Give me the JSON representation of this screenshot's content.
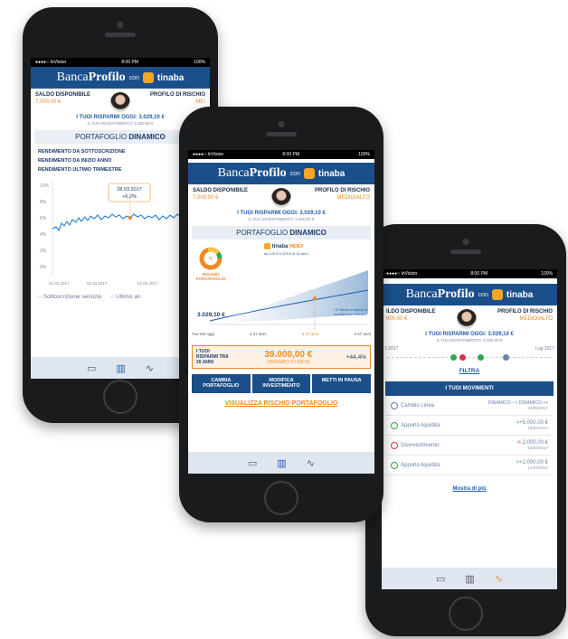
{
  "status": {
    "carrier": "●●●●○ InVision",
    "time": "8:00 PM",
    "battery": "100%"
  },
  "brand": {
    "banca": "Banca",
    "profilo": "Profilo",
    "con": "con",
    "tinaba": "tinaba"
  },
  "account": {
    "saldo_label": "SALDO DISPONIBILE",
    "saldo_value": "7.000,00 €",
    "rischio_label": "PROFILO DI RISCHIO",
    "rischio_value": "MEDIO/ALTO",
    "rischio_value_short": "MEI",
    "saldo_value_short": "000,00 €",
    "saldo_label_short": "ILDO DISPONIBILE",
    "savings": "I TUOI RISPARMI OGGI: 3.029,10 €",
    "invest": "IL TUO INVESTIMENTO: 3.000,00 €"
  },
  "portfolio": {
    "prefix": "PORTAFOGLIO",
    "name": "DINAMICO"
  },
  "phone1": {
    "rendimenti": [
      "RENDIMENTO DA SOTTOSCRIZIONE",
      "RENDIMENTO DA INIZIO ANNO",
      "RENDIMENTO ULTIMO TRIMESTRE"
    ],
    "y_ticks": [
      "10%",
      "8%",
      "6%",
      "4%",
      "2%",
      "0%"
    ],
    "x_ticks": [
      "01.01.2017",
      "01.03.2017",
      "01.05.2017",
      "01"
    ],
    "tooltip_date": "28.03.2017",
    "tooltip_value": "+6,2%",
    "radio1": "Sottoscrizione servizio",
    "radio2": "Ultimo an"
  },
  "phone2": {
    "rischio_title": "RISCHIO PORTAFOGLIO",
    "index_brand": "tinaba",
    "index_label": "INDEX",
    "index_sub": "da 100 € a 229 € in 20 anni",
    "start_value": "3.029,10 €",
    "note": "+€ Valore e banda di oscillazione indicativi",
    "ages": [
      "Tua età oggi",
      "a 37 anni",
      "a 47 anni",
      "a 57 anni"
    ],
    "proj_label": "I TUOI RISPARMI TRA 20 ANNI",
    "proj_value": "39.000,00 €",
    "proj_sub": "(VERSATO 27.000 €)",
    "proj_pct": "+44,4%",
    "buttons": [
      "CAMBIA PORTAFOGLIO",
      "MODIFICA INVESTIMENTO",
      "METTI IN PAUSA"
    ],
    "link": "VISUALIZZA RISCHIO PORTAFOGLIO"
  },
  "phone3": {
    "timeline_start": "1.2017",
    "timeline_end": "Lug 2017",
    "filter": "FILTRA",
    "movements_title": "I TUOI MOVIMENTI",
    "movements": [
      {
        "name": "Cambio Linea",
        "amount": "DINAMICO --> DINAMICO ++",
        "date": "22/05/2017",
        "color": "#6b82a8"
      },
      {
        "name": "Apporto liquidità",
        "amount": "+5.000,00 €",
        "date": "18/04/2017",
        "color": "#2fa84f"
      },
      {
        "name": "Disinvestimento",
        "amount": "-2.000,00 €",
        "date": "15/04/2017",
        "color": "#d8344a"
      },
      {
        "name": "Apporto liquidità",
        "amount": "+2.000,00 €",
        "date": "12/04/2017",
        "color": "#2fa84f"
      }
    ],
    "more": "Mostra di più"
  },
  "tabbar": {
    "icons": [
      "wallet-icon",
      "bar-chart-icon",
      "activity-icon"
    ]
  },
  "colors": {
    "brand_blue": "#1b4f8a",
    "accent_orange": "#f08a24",
    "gain_green": "#2fa84f",
    "loss_red": "#d8344a"
  }
}
